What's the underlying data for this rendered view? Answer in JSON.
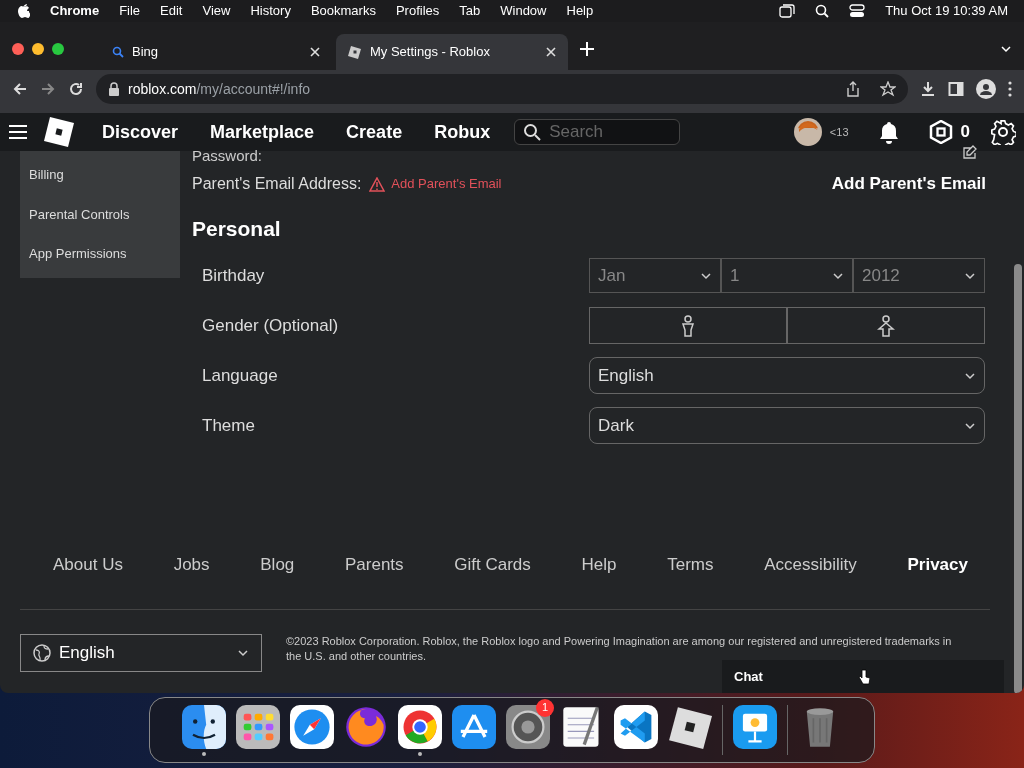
{
  "menubar": {
    "app": "Chrome",
    "items": [
      "File",
      "Edit",
      "View",
      "History",
      "Bookmarks",
      "Profiles",
      "Tab",
      "Window",
      "Help"
    ],
    "clock": "Thu Oct 19  10:39 AM"
  },
  "tabs": [
    {
      "title": "Bing",
      "selected": false
    },
    {
      "title": "My Settings - Roblox",
      "selected": true
    }
  ],
  "address": {
    "host": "roblox.com",
    "path": "/my/account#!/info"
  },
  "nav": {
    "links": [
      "Discover",
      "Marketplace",
      "Create",
      "Robux"
    ],
    "search_placeholder": "Search",
    "age": "<13",
    "robux": "0"
  },
  "sidebar": {
    "items": [
      "Billing",
      "Parental Controls",
      "App Permissions"
    ]
  },
  "account": {
    "password_label": "Password:",
    "parent_email_label": "Parent's Email Address:",
    "warning": "Add Parent's Email",
    "add_button": "Add Parent's Email"
  },
  "personal": {
    "heading": "Personal",
    "birthday": {
      "label": "Birthday",
      "month": "Jan",
      "day": "1",
      "year": "2012"
    },
    "gender": {
      "label": "Gender (Optional)"
    },
    "language": {
      "label": "Language",
      "value": "English"
    },
    "theme": {
      "label": "Theme",
      "value": "Dark"
    }
  },
  "footer": {
    "links": [
      {
        "label": "About Us",
        "emphasized": false
      },
      {
        "label": "Jobs",
        "emphasized": false
      },
      {
        "label": "Blog",
        "emphasized": false
      },
      {
        "label": "Parents",
        "emphasized": false
      },
      {
        "label": "Gift Cards",
        "emphasized": false
      },
      {
        "label": "Help",
        "emphasized": false
      },
      {
        "label": "Terms",
        "emphasized": false
      },
      {
        "label": "Accessibility",
        "emphasized": false
      },
      {
        "label": "Privacy",
        "emphasized": true
      }
    ],
    "language": "English",
    "copyright": "©2023 Roblox Corporation. Roblox, the Roblox logo and Powering Imagination are among our registered and unregistered trademarks in the U.S. and other countries."
  },
  "chat": {
    "title": "Chat"
  },
  "dock": [
    {
      "kind": "finder",
      "running": true
    },
    {
      "kind": "launchpad",
      "running": false
    },
    {
      "kind": "safari",
      "running": false
    },
    {
      "kind": "firefox",
      "running": false
    },
    {
      "kind": "chrome",
      "running": true
    },
    {
      "kind": "appstore",
      "running": false
    },
    {
      "kind": "settings",
      "running": false,
      "badge": "1"
    },
    {
      "kind": "textedit",
      "running": false
    },
    {
      "kind": "vscode",
      "running": false
    },
    {
      "kind": "roblox",
      "running": false
    },
    {
      "kind": "keynote",
      "running": false
    },
    {
      "kind": "trash",
      "running": false
    }
  ]
}
